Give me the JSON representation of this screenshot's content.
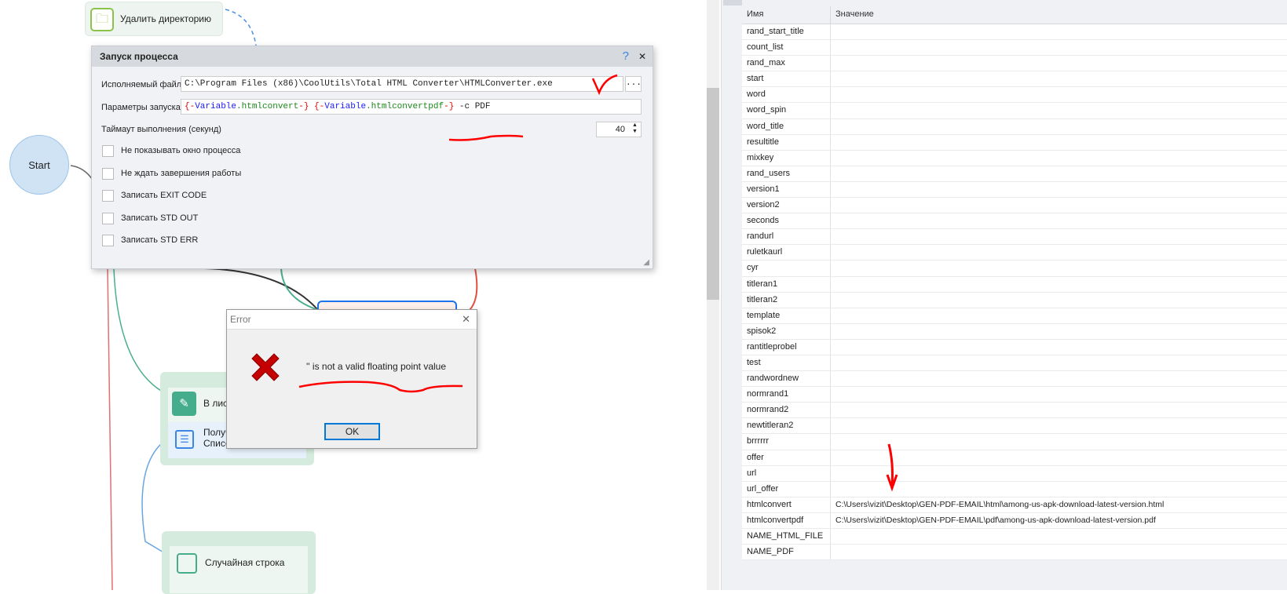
{
  "canvas": {
    "nodes": {
      "delete_dir": "Удалить директорию",
      "start": "Start",
      "to_list": "В лист",
      "get_list_line1": "Получ",
      "get_list_line2": "Списо",
      "random_line": "Случайная строка"
    }
  },
  "process_dialog": {
    "title": "Запуск процесса",
    "help": "?",
    "close": "✕",
    "exe_label": "Исполняемый файл",
    "exe_value": "C:\\Program Files (x86)\\CoolUtils\\Total HTML Converter\\HTMLConverter.exe",
    "browse": "...",
    "params_label": "Параметры запуска",
    "params": [
      {
        "text": "{-",
        "color": "#e00000"
      },
      {
        "text": "Variable",
        "color": "#1a1aff"
      },
      {
        "text": ".htmlconvert",
        "color": "#1a8a1a"
      },
      {
        "text": "-}",
        "color": "#e00000"
      },
      {
        "text": " ",
        "color": "#222"
      },
      {
        "text": "{-",
        "color": "#e00000"
      },
      {
        "text": "Variable",
        "color": "#1a1aff"
      },
      {
        "text": ".htmlconvertpdf",
        "color": "#1a8a1a"
      },
      {
        "text": "-}",
        "color": "#e00000"
      },
      {
        "text": " -c PDF",
        "color": "#222"
      }
    ],
    "timeout_label": "Таймаут выполнения (секунд)",
    "timeout_value": "40",
    "checkboxes": [
      "Не показывать окно процесса",
      "Не ждать завершения работы",
      "Записать EXIT CODE",
      "Записать STD OUT",
      "Записать STD ERR"
    ]
  },
  "error_dialog": {
    "title": "Error",
    "close": "✕",
    "message": "'' is not a valid floating point value",
    "ok": "OK"
  },
  "variables": {
    "headers": [
      "Имя",
      "Значение"
    ],
    "rows": [
      {
        "name": "rand_start_title",
        "value": ""
      },
      {
        "name": "count_list",
        "value": ""
      },
      {
        "name": "rand_max",
        "value": ""
      },
      {
        "name": "start",
        "value": ""
      },
      {
        "name": "word",
        "value": ""
      },
      {
        "name": "word_spin",
        "value": ""
      },
      {
        "name": "word_title",
        "value": ""
      },
      {
        "name": "resultitle",
        "value": ""
      },
      {
        "name": "mixkey",
        "value": ""
      },
      {
        "name": "rand_users",
        "value": ""
      },
      {
        "name": "version1",
        "value": ""
      },
      {
        "name": "version2",
        "value": ""
      },
      {
        "name": "seconds",
        "value": ""
      },
      {
        "name": "randurl",
        "value": ""
      },
      {
        "name": "ruletkaurl",
        "value": ""
      },
      {
        "name": "cyr",
        "value": ""
      },
      {
        "name": "titleran1",
        "value": ""
      },
      {
        "name": "titleran2",
        "value": ""
      },
      {
        "name": "template",
        "value": ""
      },
      {
        "name": "spisok2",
        "value": ""
      },
      {
        "name": "rantitleprobel",
        "value": ""
      },
      {
        "name": "test",
        "value": ""
      },
      {
        "name": "randwordnew",
        "value": ""
      },
      {
        "name": "normrand1",
        "value": ""
      },
      {
        "name": "normrand2",
        "value": ""
      },
      {
        "name": "newtitleran2",
        "value": ""
      },
      {
        "name": "brrrrrr",
        "value": ""
      },
      {
        "name": "offer",
        "value": ""
      },
      {
        "name": "url",
        "value": ""
      },
      {
        "name": "url_offer",
        "value": ""
      },
      {
        "name": "htmlconvert",
        "value": "C:\\Users\\vizit\\Desktop\\GEN-PDF-EMAIL\\html\\among-us-apk-download-latest-version.html"
      },
      {
        "name": "htmlconvertpdf",
        "value": "C:\\Users\\vizit\\Desktop\\GEN-PDF-EMAIL\\pdf\\among-us-apk-download-latest-version.pdf"
      },
      {
        "name": "NAME_HTML_FILE",
        "value": ""
      },
      {
        "name": "NAME_PDF",
        "value": ""
      }
    ]
  },
  "colors": {
    "annotation": "#ff0000",
    "accent": "#1a73e8",
    "node_green": "#4caf8a"
  }
}
